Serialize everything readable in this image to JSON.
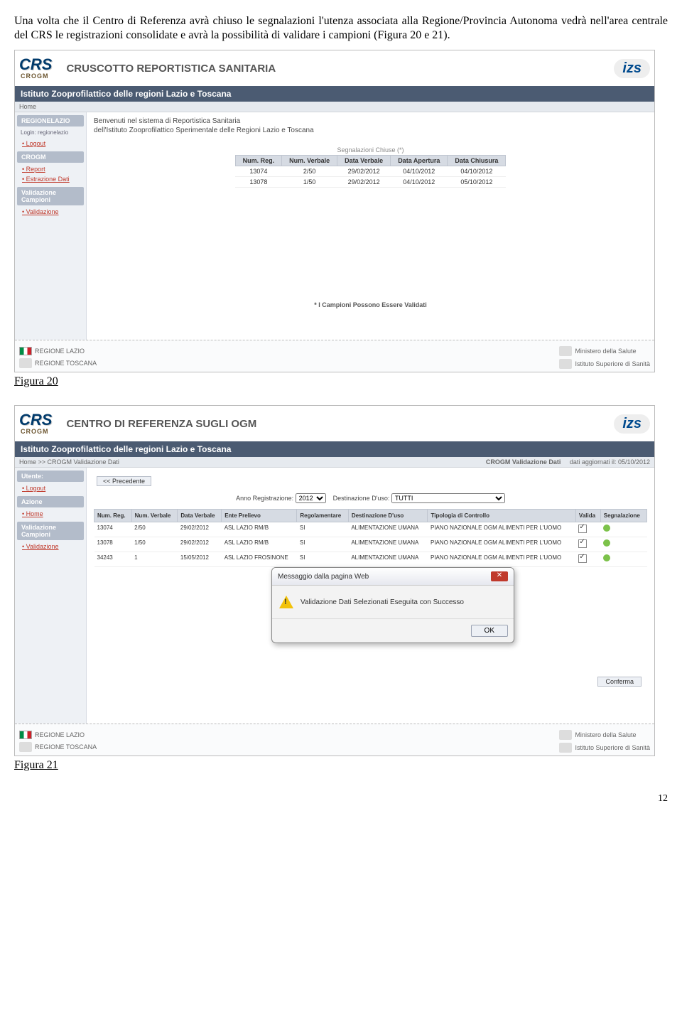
{
  "paragraph": "Una volta che il Centro di Referenza avrà chiuso le segnalazioni l'utenza associata alla Regione/Provincia Autonoma vedrà nell'area centrale del CRS le registrazioni consolidate e avrà la possibilità di validare i campioni (Figura 20 e 21).",
  "fig20": {
    "title_main": "CRUSCOTTO REPORTISTICA SANITARIA",
    "institute": "Istituto Zooprofilattico delle regioni Lazio e Toscana",
    "crumb_left": "Home",
    "welcome_l1": "Benvenuti nel sistema di Reportistica Sanitaria",
    "welcome_l2": "dell'Istituto Zooprofilattico Sperimentale delle Regioni Lazio e Toscana",
    "sidebar": {
      "sec1": "REGIONELAZIO",
      "sec1_sub": "Login: regionelazio",
      "link_logout": "Logout",
      "sec2": "CROGM",
      "link_report": "Report",
      "link_estr": "Estrazione Dati",
      "sec3": "Validazione Campioni",
      "link_valid": "Validazione"
    },
    "table_caption": "Segnalazioni Chiuse (*)",
    "headers": [
      "Num. Reg.",
      "Num. Verbale",
      "Data Verbale",
      "Data Apertura",
      "Data Chiusura"
    ],
    "rows": [
      [
        "13074",
        "2/50",
        "29/02/2012",
        "04/10/2012",
        "04/10/2012"
      ],
      [
        "13078",
        "1/50",
        "29/02/2012",
        "04/10/2012",
        "05/10/2012"
      ]
    ],
    "note": "* I Campioni Possono Essere Validati",
    "foot_left": [
      "REGIONE LAZIO",
      "REGIONE TOSCANA"
    ],
    "foot_right": [
      "Ministero della Salute",
      "Istituto Superiore di Sanità"
    ],
    "caption": "Figura 20"
  },
  "fig21": {
    "title_main": "CENTRO DI REFERENZA SUGLI OGM",
    "institute": "Istituto Zooprofilattico delle regioni Lazio e Toscana",
    "crumb_left": "Home >> CROGM Validazione Dati",
    "crumb_right_a": "CROGM Validazione Dati",
    "crumb_right_b": "dati aggiornati il: 05/10/2012",
    "prev": "<< Precedente",
    "sidebar": {
      "sec1": "Utente:",
      "link_logout": "Logout",
      "sec2": "Azione",
      "link_home": "Home",
      "sec3": "Validazione Campioni",
      "link_valid": "Validazione"
    },
    "filters": {
      "l_anno": "Anno Registrazione:",
      "v_anno": "2012",
      "l_dest": "Destinazione D'uso:",
      "v_dest": "TUTTI"
    },
    "headers": [
      "Num. Reg.",
      "Num. Verbale",
      "Data Verbale",
      "Ente Prelievo",
      "Regolamentare",
      "Destinazione D'uso",
      "Tipologia di Controllo",
      "Valida",
      "Segnalazione"
    ],
    "rows": [
      {
        "reg": "13074",
        "verb": "2/50",
        "data": "29/02/2012",
        "ente": "ASL LAZIO RM/B",
        "rego": "SI",
        "dest": "ALIMENTAZIONE UMANA",
        "tipo": "PIANO NAZIONALE OGM ALIMENTI PER L'UOMO",
        "valida": true
      },
      {
        "reg": "13078",
        "verb": "1/50",
        "data": "29/02/2012",
        "ente": "ASL LAZIO RM/B",
        "rego": "SI",
        "dest": "ALIMENTAZIONE UMANA",
        "tipo": "PIANO NAZIONALE OGM ALIMENTI PER L'UOMO",
        "valida": true
      },
      {
        "reg": "34243",
        "verb": "1",
        "data": "15/05/2012",
        "ente": "ASL LAZIO FROSINONE",
        "rego": "SI",
        "dest": "ALIMENTAZIONE UMANA",
        "tipo": "PIANO NAZIONALE OGM ALIMENTI PER L'UOMO",
        "valida": true
      }
    ],
    "conferma": "Conferma",
    "dialog": {
      "title": "Messaggio dalla pagina Web",
      "body": "Validazione Dati Selezionati Eseguita con Successo",
      "ok": "OK"
    },
    "foot_left": [
      "REGIONE LAZIO",
      "REGIONE TOSCANA"
    ],
    "foot_right": [
      "Ministero della Salute",
      "Istituto Superiore di Sanità"
    ],
    "caption": "Figura 21"
  },
  "page_number": "12"
}
